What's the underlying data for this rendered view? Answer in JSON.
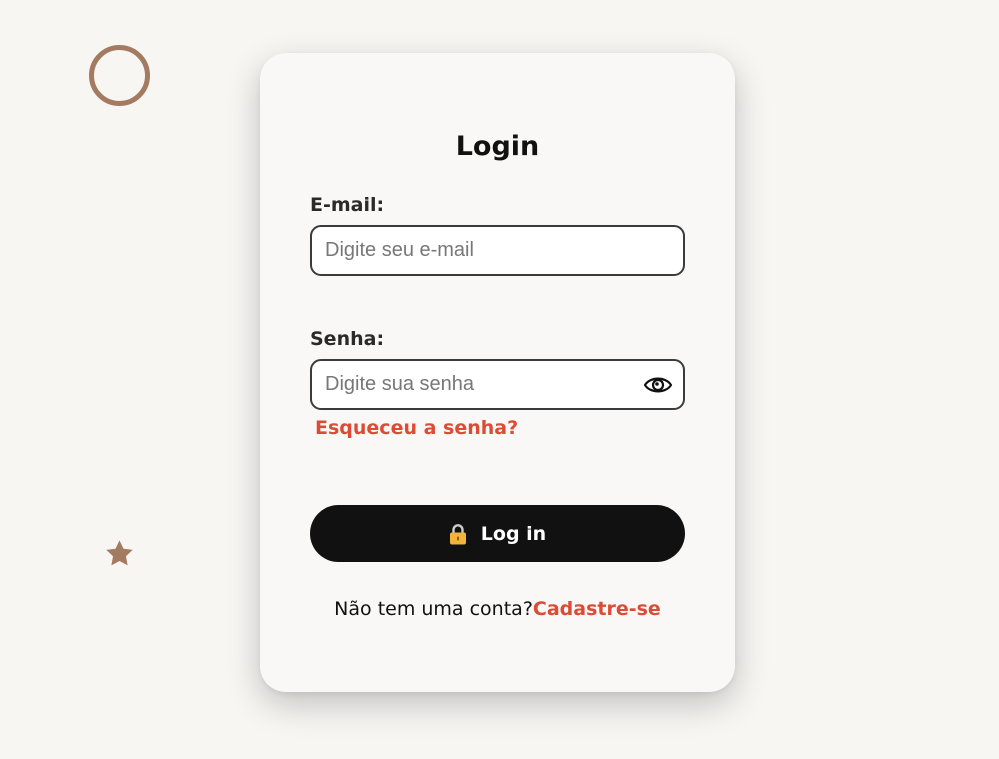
{
  "decorations": {
    "circle_icon": "circle-outline-icon",
    "star_icon": "star-icon",
    "accent_color": "#a47a61"
  },
  "login_form": {
    "title": "Login",
    "email": {
      "label": "E-mail:",
      "placeholder": "Digite seu e-mail",
      "value": ""
    },
    "password": {
      "label": "Senha:",
      "placeholder": "Digite sua senha",
      "value": "",
      "toggle_icon": "eye-icon"
    },
    "forgot_password": "Esqueceu a senha?",
    "submit": {
      "icon": "lock-icon",
      "label": "Log in"
    },
    "signup": {
      "prompt": "Não tem uma conta?",
      "link": "Cadastre-se"
    }
  },
  "colors": {
    "background": "#f7f6f3",
    "card": "#f9f8f6",
    "link": "#db4b35",
    "button": "#111111",
    "lock": "#f4b43a"
  }
}
